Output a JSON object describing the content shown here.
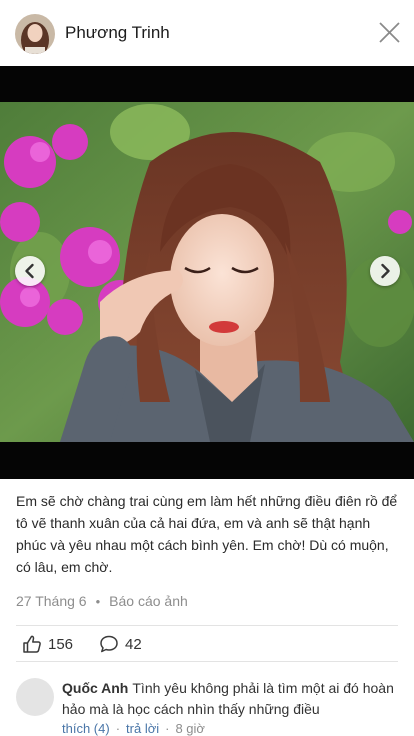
{
  "header": {
    "author_name": "Phương Trinh",
    "close_icon": "close-icon"
  },
  "photo": {
    "prev_icon": "chevron-left-icon",
    "next_icon": "chevron-right-icon"
  },
  "post": {
    "caption": "Em sẽ chờ chàng trai cùng em làm hết những điều điên rồ để tô vẽ thanh xuân của cả hai đứa, em và anh sẽ thật hạnh phúc và yêu nhau một cách bình yên. Em chờ! Dù có muộn, có lâu, em chờ.",
    "date": "27 Tháng 6",
    "separator": "•",
    "report_label": "Báo cáo ảnh"
  },
  "reactions": {
    "like_count": "156",
    "comment_count": "42"
  },
  "comment": {
    "author": "Quốc Anh",
    "text": "Tình yêu không phải là tìm một ai đó hoàn hảo mà là học cách nhìn thấy những điều",
    "like_label": "thích (4)",
    "reply_label": "trả lời",
    "separator": "·",
    "time": "8 giờ"
  },
  "colors": {
    "link": "#4a76a8",
    "meta_text": "#8d8d8d",
    "photo_letterbox": "#050505"
  }
}
